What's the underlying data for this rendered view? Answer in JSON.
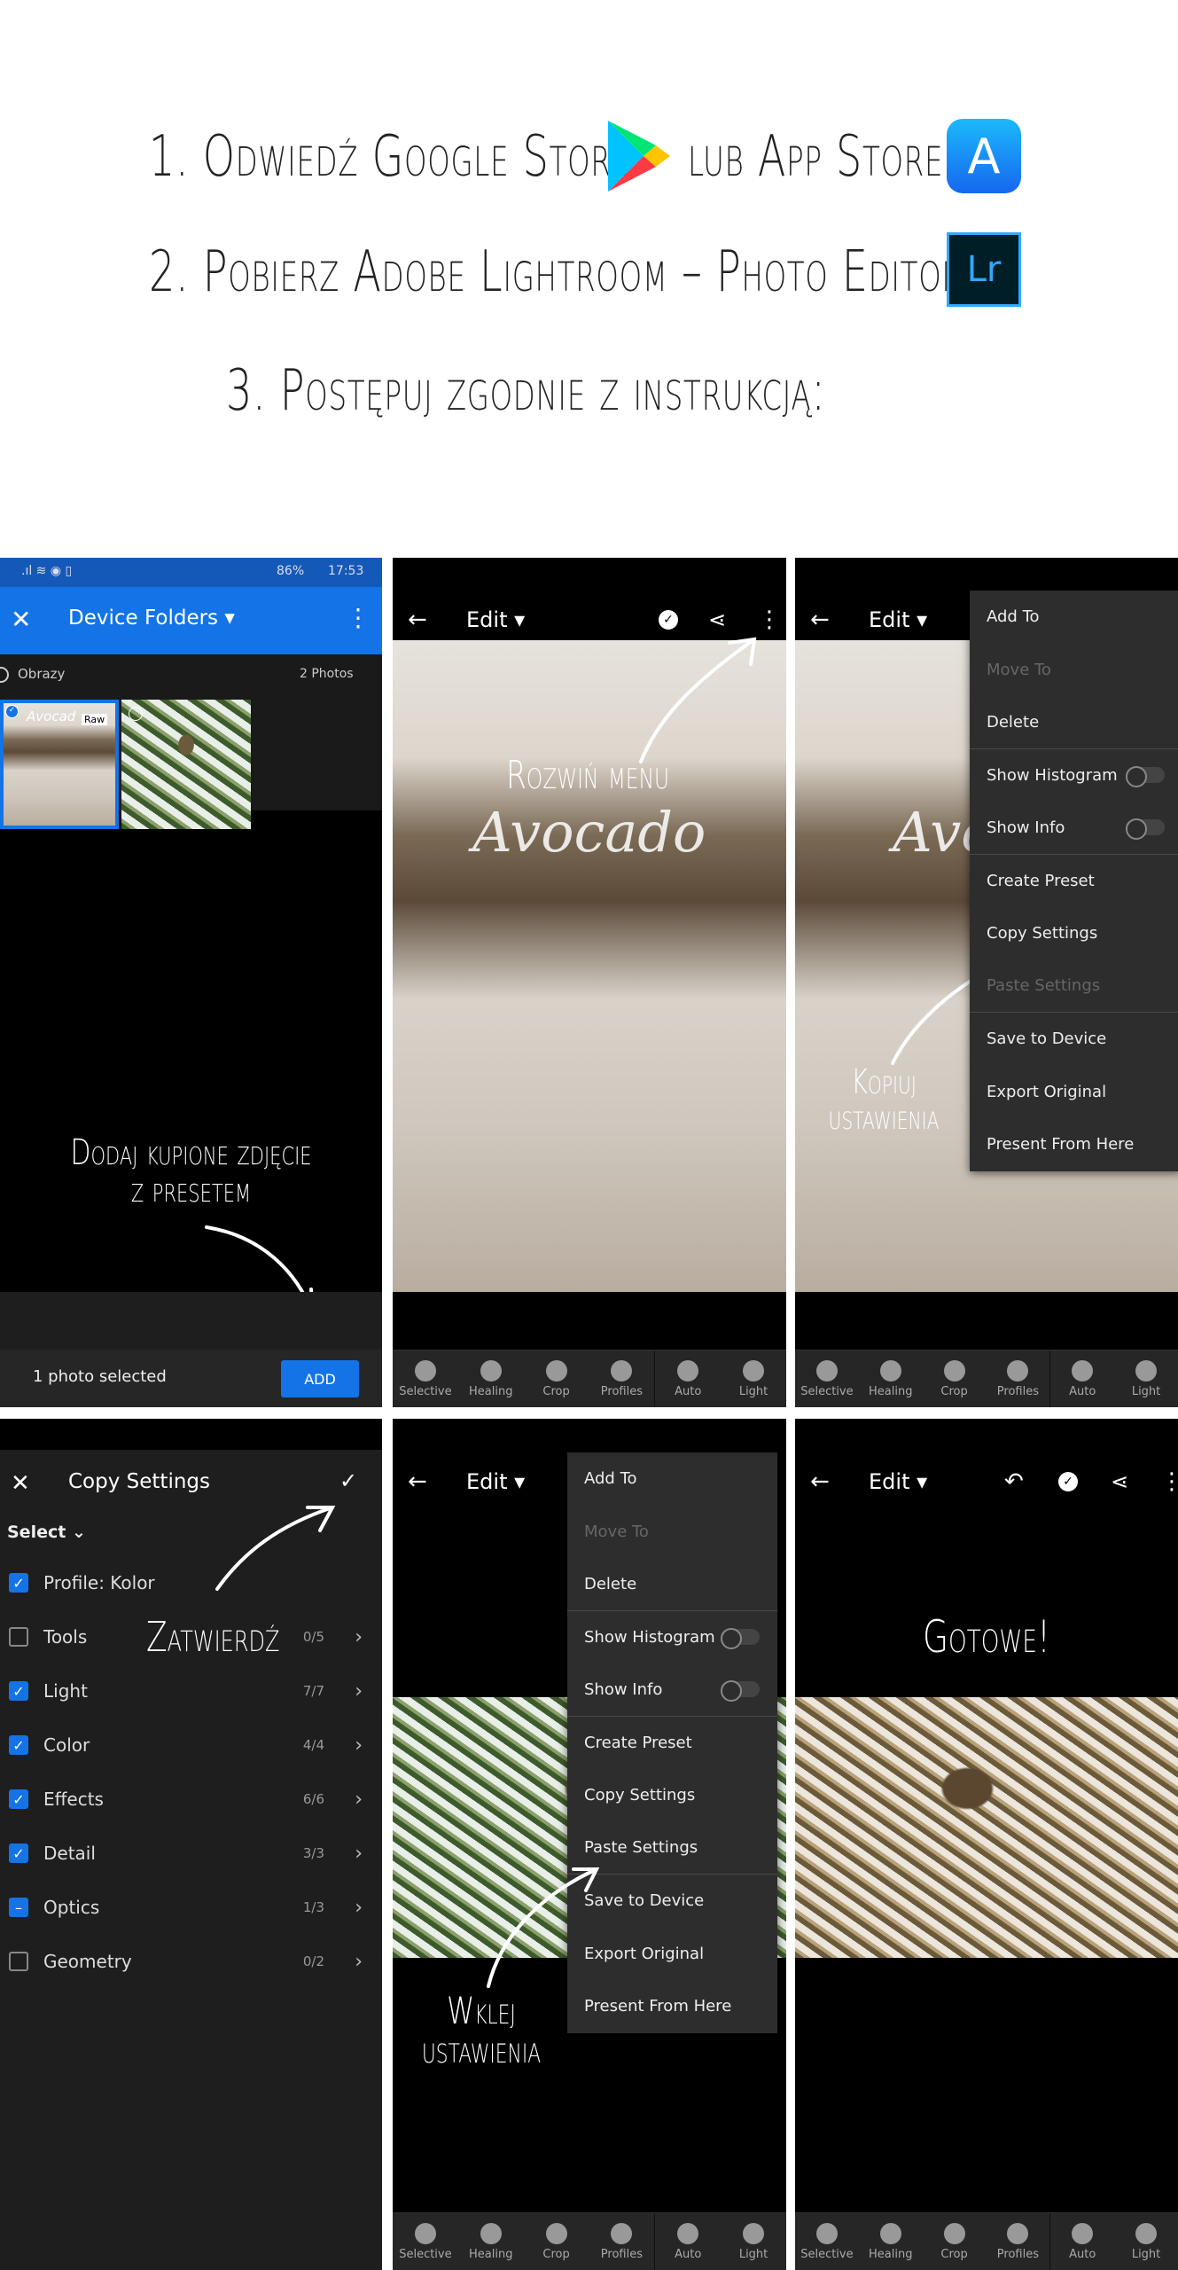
{
  "instructions": {
    "line1": "1. Odwiedź Google Store",
    "line1_or": "lub App Store",
    "line2": "2. Pobierz Adobe Lightroom – Photo Editor",
    "line2_logo": "Lr",
    "line3": "3. Postępuj zgodnie z instrukcją:"
  },
  "step1": {
    "status": {
      "battery": "86%",
      "time": "17:53"
    },
    "title": "Device Folders",
    "folder": "Obrazy",
    "count": "2 Photos",
    "raw_badge": "Raw",
    "thumb_watermark": "Avocad",
    "caption": "Dodaj kupione zdjęcie z presetem",
    "selected": "1 photo selected",
    "add": "ADD",
    "accent": "#1473e6"
  },
  "edit": {
    "title": "Edit",
    "watermark_top": "Rozwiń menu",
    "watermark_brand": "Avocado"
  },
  "toolbar": [
    "Selective",
    "Healing",
    "Crop",
    "Profiles",
    "Auto",
    "Light"
  ],
  "menu_step3": [
    {
      "label": "Add To"
    },
    {
      "label": "Move To",
      "disabled": true
    },
    {
      "label": "Delete",
      "divider": true
    },
    {
      "label": "Show Histogram",
      "toggle": false
    },
    {
      "label": "Show Info",
      "toggle": false,
      "divider": true
    },
    {
      "label": "Create Preset"
    },
    {
      "label": "Copy Settings"
    },
    {
      "label": "Paste Settings",
      "disabled": true,
      "divider": true
    },
    {
      "label": "Save to Device"
    },
    {
      "label": "Export Original"
    },
    {
      "label": "Present From Here"
    }
  ],
  "menu_step5": [
    {
      "label": "Add To"
    },
    {
      "label": "Move To",
      "disabled": true
    },
    {
      "label": "Delete",
      "divider": true
    },
    {
      "label": "Show Histogram",
      "toggle": false
    },
    {
      "label": "Show Info",
      "toggle": false,
      "divider": true
    },
    {
      "label": "Create Preset"
    },
    {
      "label": "Copy Settings"
    },
    {
      "label": "Paste Settings",
      "divider": true
    },
    {
      "label": "Save to Device"
    },
    {
      "label": "Export Original"
    },
    {
      "label": "Present From Here"
    }
  ],
  "step3": {
    "caption": "Kopiuj ustawienia"
  },
  "copy_settings": {
    "title": "Copy Settings",
    "select": "Select",
    "caption": "Zatwierdź",
    "rows": [
      {
        "label": "Profile: Kolor",
        "state": "on",
        "count": ""
      },
      {
        "label": "Tools",
        "state": "off",
        "count": "0/5"
      },
      {
        "label": "Light",
        "state": "on",
        "count": "7/7"
      },
      {
        "label": "Color",
        "state": "on",
        "count": "4/4"
      },
      {
        "label": "Effects",
        "state": "on",
        "count": "6/6"
      },
      {
        "label": "Detail",
        "state": "on",
        "count": "3/3"
      },
      {
        "label": "Optics",
        "state": "part",
        "count": "1/3"
      },
      {
        "label": "Geometry",
        "state": "off",
        "count": "0/2"
      }
    ]
  },
  "step5": {
    "caption": "Wklej ustawienia"
  },
  "step6": {
    "caption": "Gotowe!"
  }
}
